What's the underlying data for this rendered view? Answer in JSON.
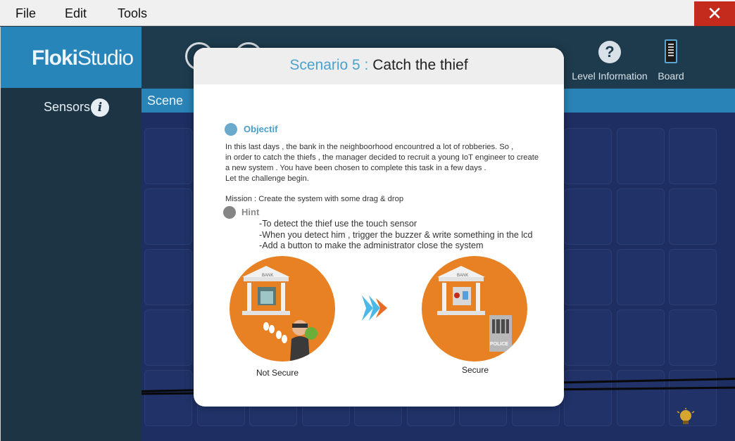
{
  "menu": {
    "file": "File",
    "edit": "Edit",
    "tools": "Tools",
    "close": "✕"
  },
  "sidebar": {
    "logo_bold": "Floki",
    "logo_light": "Studio",
    "sensors_label": "Sensors",
    "info_icon": "i"
  },
  "toolbar": {
    "level_info_label": "Level Information",
    "help_icon": "?",
    "board_label": "Board"
  },
  "scene": {
    "label": "Scene"
  },
  "modal": {
    "title_prefix": "Scenario 5 :",
    "title_main": "Catch the thief",
    "objective_heading": "Objectif",
    "objective_lines": [
      "In this last days , the bank in the neighboorhood encountred a lot of robberies. So ,",
      "in order to catch the thiefs , the manager decided to recruit a young IoT engineer to create",
      "a new system . You have been chosen to complete this task in a few days .",
      "Let the challenge begin."
    ],
    "mission": "Mission : Create the system with some drag & drop",
    "hint_heading": "Hint",
    "hints": [
      "-To detect the thief use the touch sensor",
      "-When you detect him , trigger the buzzer & write something in the lcd",
      "-Add a button to make the administrator close the system"
    ],
    "bank_sign": "BANK",
    "police_sign": "POLICE",
    "not_secure_label": "Not Secure",
    "secure_label": "Secure"
  },
  "colors": {
    "accent_blue": "#4aa3cf",
    "orange": "#e88124",
    "close_red": "#c42b1c"
  }
}
